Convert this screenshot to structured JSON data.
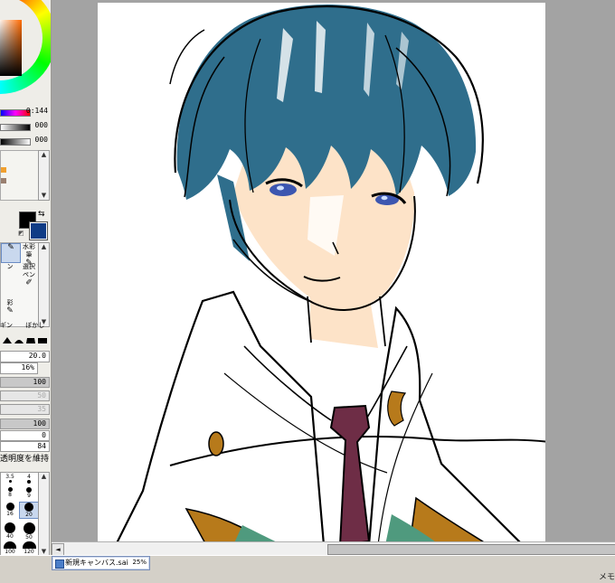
{
  "colors": {
    "hair": "#2f6e8c",
    "skin": "#fde3c8",
    "tie": "#6e2d46",
    "collar_trim": "#b77a1b",
    "collar_green": "#4f9a7e",
    "eye": "#3c56b0",
    "primary": "#000000",
    "secondary": "#103c86"
  },
  "color_panel": {
    "hue_value": "0:144",
    "saturation_value": "000",
    "value_value": "000"
  },
  "tools": {
    "watercolor_label": "水彩筆",
    "pen_label": "ン",
    "selection_pen_label": "選択ペン",
    "label_4": "彩",
    "label_5": "ギン",
    "label_6": "ぼかし"
  },
  "brush_params": {
    "size": "20.0",
    "min_size": "16%",
    "density": "100",
    "blend": "50",
    "dilution": "35",
    "persistence": "100",
    "param_5": "0",
    "param_6": "84",
    "keep_opacity_label": "透明度を維持"
  },
  "brush_sizes": [
    "3.5",
    "4",
    "8",
    "9",
    "16",
    "20",
    "40",
    "50",
    "100",
    "120"
  ],
  "status": {
    "document_name": "新規キャンバス.sai",
    "zoom": "25%",
    "memory_label": "メモ"
  }
}
